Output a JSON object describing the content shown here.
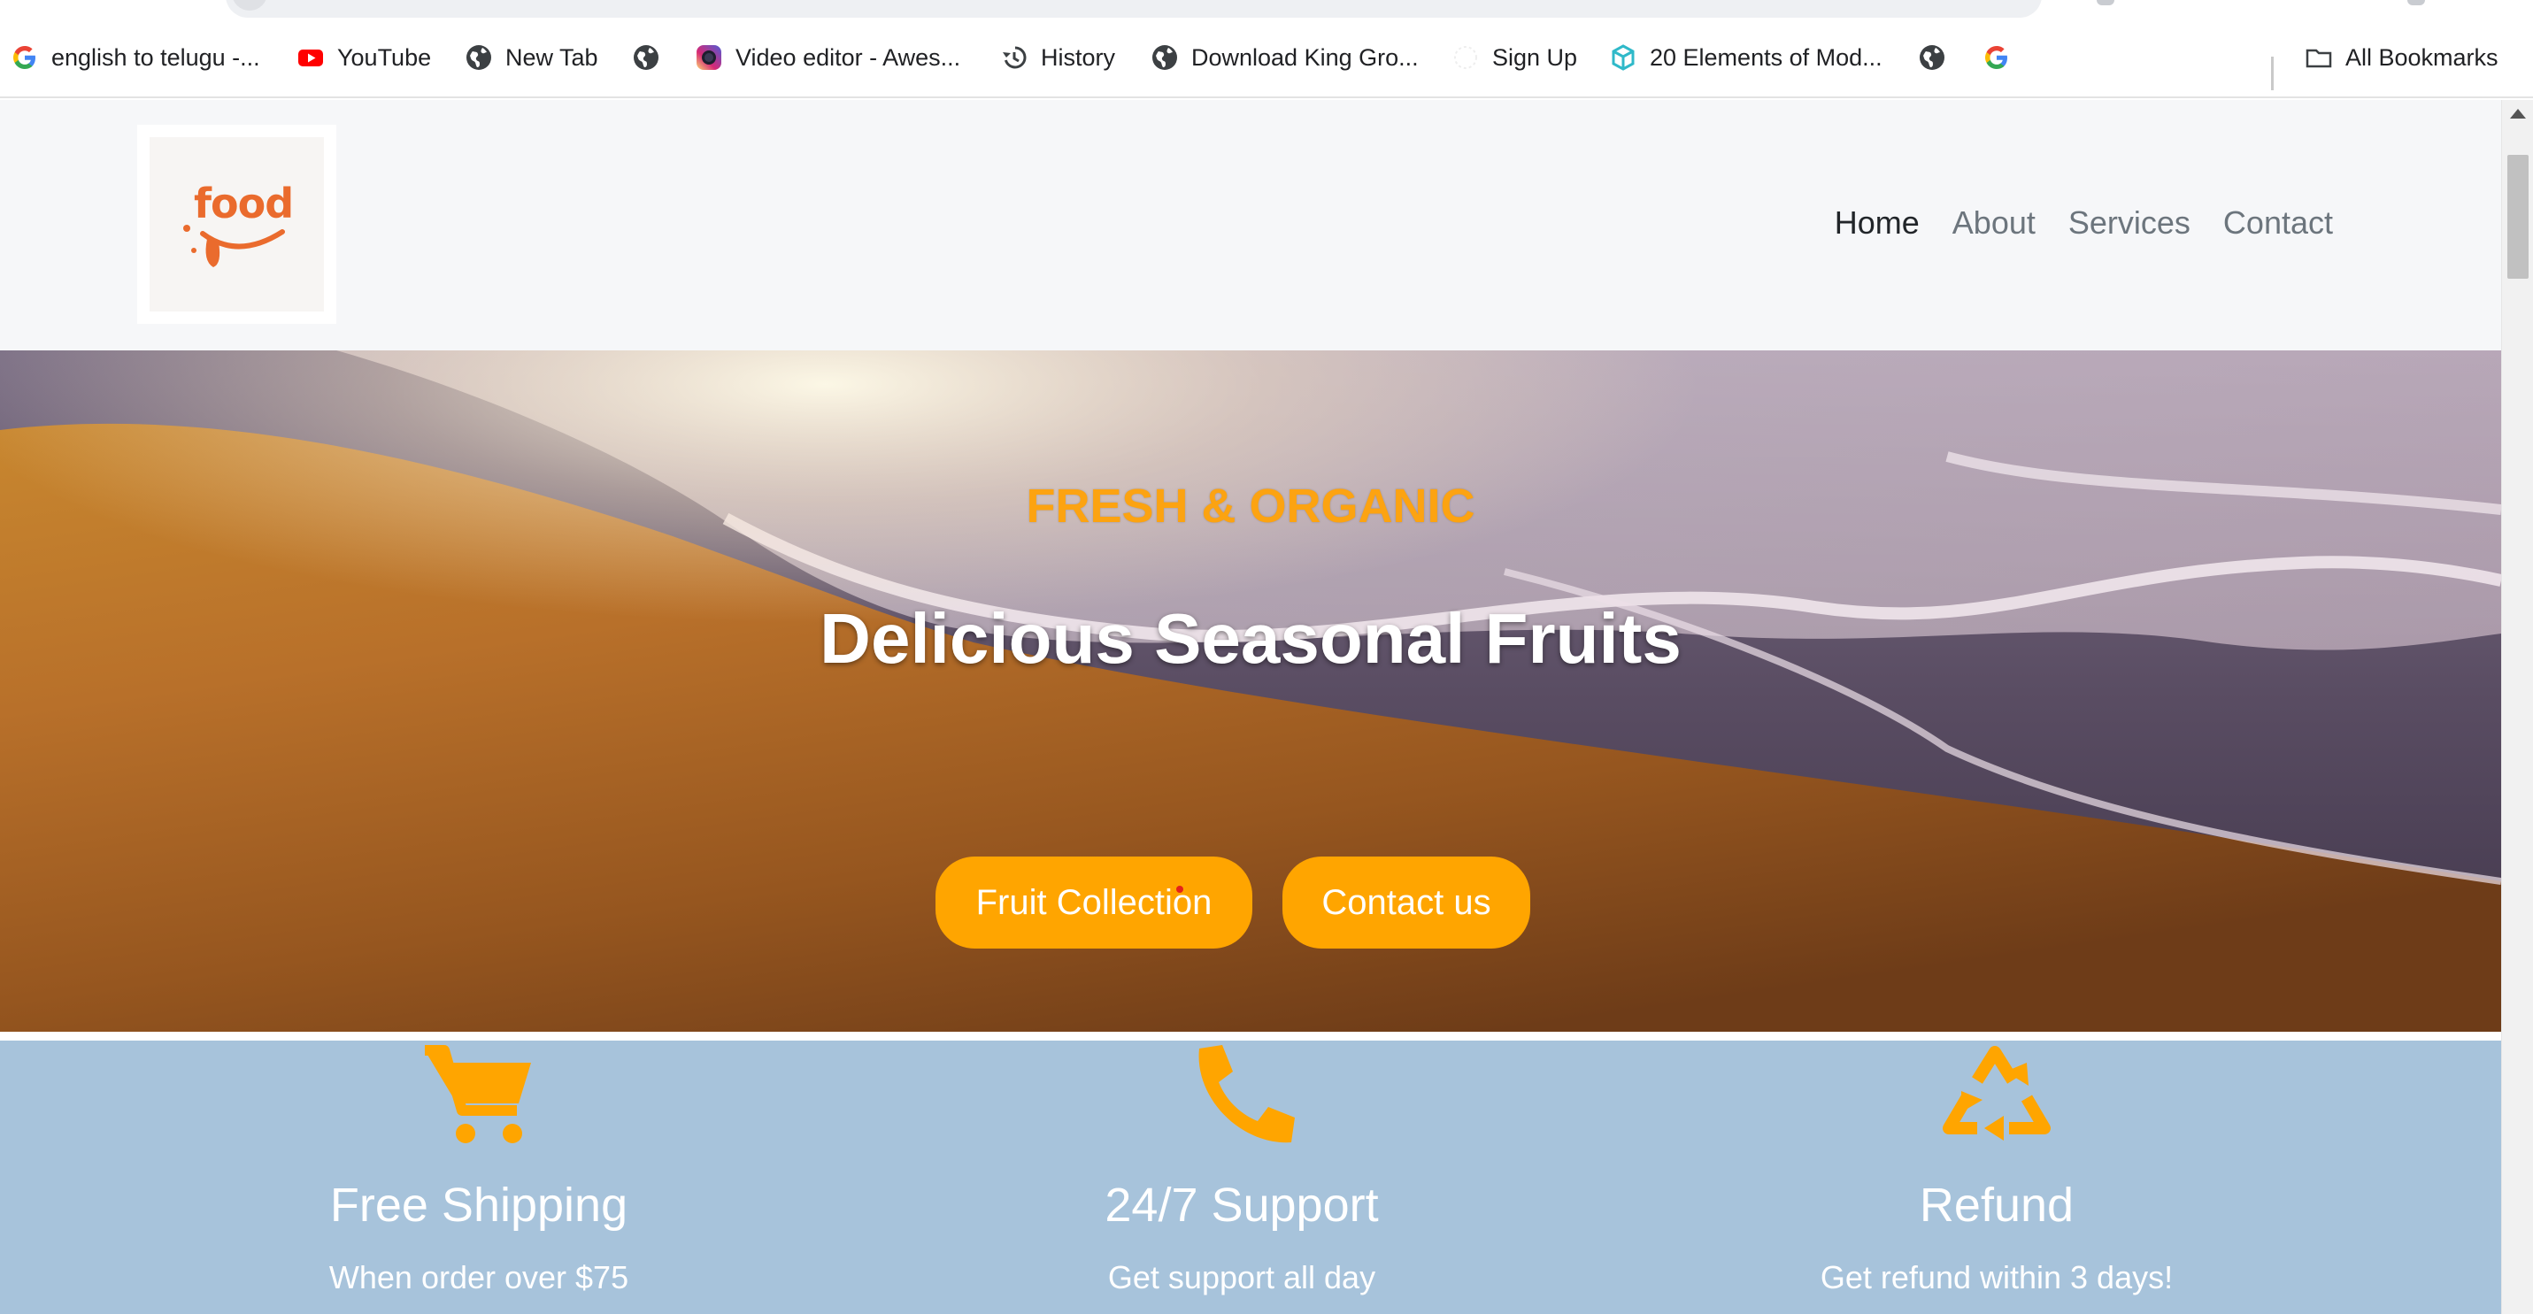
{
  "browser": {
    "bookmarks": [
      {
        "label": "english to telugu -...",
        "icon": "google-g-icon"
      },
      {
        "label": "YouTube",
        "icon": "youtube-icon"
      },
      {
        "label": "New Tab",
        "icon": "globe-icon"
      },
      {
        "label": "",
        "icon": "globe-icon"
      },
      {
        "label": "Video editor - Awes...",
        "icon": "instagram-icon"
      },
      {
        "label": "History",
        "icon": "history-icon"
      },
      {
        "label": "Download King Gro...",
        "icon": "globe-icon"
      },
      {
        "label": "Sign Up",
        "icon": "blank-icon"
      },
      {
        "label": "20 Elements of Mod...",
        "icon": "cube-icon"
      },
      {
        "label": "",
        "icon": "globe-icon"
      },
      {
        "label": "",
        "icon": "google-g-icon"
      }
    ],
    "all_bookmarks_label": "All Bookmarks"
  },
  "site": {
    "logo_text": "food",
    "nav": [
      {
        "label": "Home",
        "active": true
      },
      {
        "label": "About",
        "active": false
      },
      {
        "label": "Services",
        "active": false
      },
      {
        "label": "Contact",
        "active": false
      }
    ],
    "hero": {
      "eyebrow": "FRESH & ORGANIC",
      "title": "Delicious Seasonal Fruits",
      "primary_button": "Fruit Collection",
      "secondary_button": "Contact us"
    },
    "features": [
      {
        "icon": "cart-icon",
        "title": "Free Shipping",
        "subtitle": "When order over $75"
      },
      {
        "icon": "phone-icon",
        "title": "24/7 Support",
        "subtitle": "Get support all day"
      },
      {
        "icon": "recycle-icon",
        "title": "Refund",
        "subtitle": "Get refund within 3 days!"
      }
    ]
  },
  "colors": {
    "accent": "#ffa500",
    "eyebrow": "#fca311",
    "features_bg": "#a7c3db",
    "logo": "#ea6b2d"
  }
}
